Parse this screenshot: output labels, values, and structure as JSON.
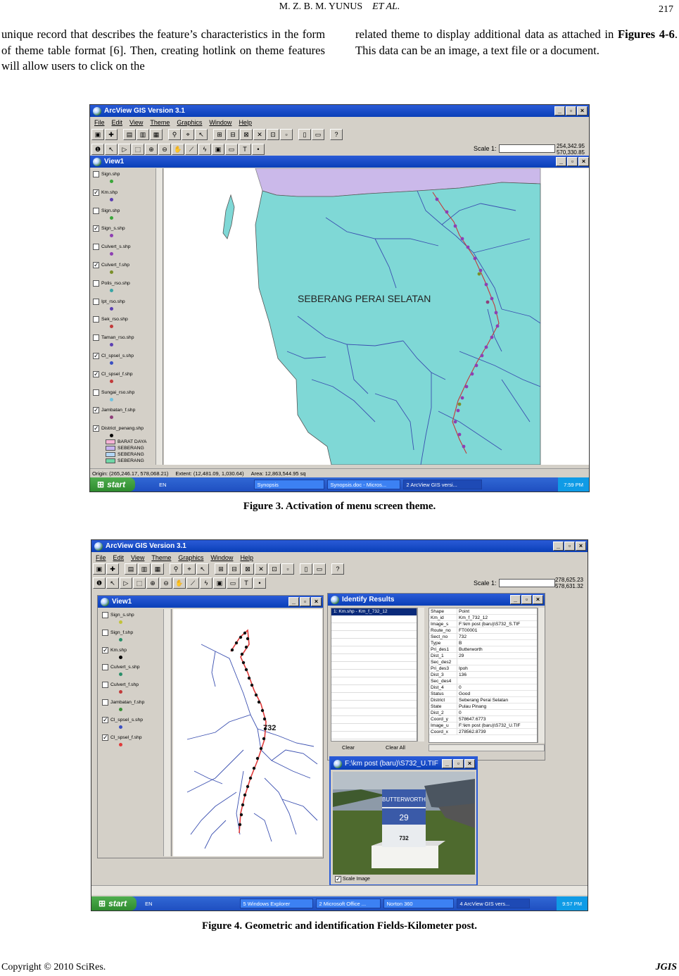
{
  "header": {
    "authors": "M. Z. B. M. YUNUS",
    "et_al": "ET AL.",
    "page_number": "217"
  },
  "body": {
    "left_column": "unique record that describes the feature’s characteristics in the form of theme table format [6]. Then, creating hotlink on theme features will allow users to click on the",
    "right_column_prefix": "related theme to display additional data as attached in ",
    "right_column_bold": "Figures 4-6",
    "right_column_suffix": ". This data can be an image, a text file or a document."
  },
  "figure3": {
    "caption": "Figure 3. Activation of menu screen theme.",
    "app_title": "ArcView GIS Version 3.1",
    "menus": [
      "File",
      "Edit",
      "View",
      "Theme",
      "Graphics",
      "Window",
      "Help"
    ],
    "scale_label": "Scale 1:",
    "coord_x": "254,342.95",
    "coord_y": "570,330.85",
    "view_title": "View1",
    "map_label": "SEBERANG PERAI SELATAN",
    "layers": [
      {
        "name": "Sign.shp",
        "checked": false,
        "color": "#3aa63a"
      },
      {
        "name": "Km.shp",
        "checked": true,
        "color": "#5b3fb3"
      },
      {
        "name": "Sign.shp",
        "checked": false,
        "color": "#3aa63a"
      },
      {
        "name": "Sign_s.shp",
        "checked": true,
        "color": "#8e3fb3"
      },
      {
        "name": "Culvert_s.shp",
        "checked": false,
        "color": "#8e3fb3"
      },
      {
        "name": "Culvert_f.shp",
        "checked": true,
        "color": "#7a8f2a"
      },
      {
        "name": "Polis_rso.shp",
        "checked": false,
        "color": "#3aa6a6"
      },
      {
        "name": "Ipt_rso.shp",
        "checked": false,
        "color": "#5b3fb3"
      },
      {
        "name": "Sek_rso.shp",
        "checked": false,
        "color": "#c23a3a"
      },
      {
        "name": "Taman_rso.shp",
        "checked": false,
        "color": "#5b3fb3"
      },
      {
        "name": "Cl_spsel_s.shp",
        "checked": true,
        "color": "#3a4fc2"
      },
      {
        "name": "Cl_spsel_f.shp",
        "checked": true,
        "color": "#c23a3a"
      },
      {
        "name": "Sungai_rso.shp",
        "checked": false,
        "color": "#6fc2e0"
      },
      {
        "name": "Jambatan_f.shp",
        "checked": true,
        "color": "#8e3f7a"
      },
      {
        "name": "District_penang.shp",
        "checked": true,
        "color": "#000"
      }
    ],
    "district_legend": [
      {
        "name": "BARAT DAYA",
        "color": "#f5b3d6"
      },
      {
        "name": "SEBERANG",
        "color": "#c8b3f0"
      },
      {
        "name": "SEBERANG",
        "color": "#b3d6f5"
      },
      {
        "name": "SEBERANG",
        "color": "#6fd6a6"
      }
    ],
    "status_origin": "Origin: (265,246.17, 578,068.21)",
    "status_extent": "Extent: (12,481.09, 1,030.64)",
    "status_area": "Area: 12,863,544.95 sq",
    "taskbar": {
      "start": "start",
      "lang": "EN",
      "tasks": [
        "Synopsis",
        "Synopsis.doc - Micros...",
        "2 ArcView GIS versi..."
      ],
      "clock": "7:59 PM"
    }
  },
  "figure4": {
    "caption": "Figure 4. Geometric and identification Fields-Kilometer post.",
    "app_title": "ArcView GIS Version 3.1",
    "menus": [
      "File",
      "Edit",
      "View",
      "Theme",
      "Graphics",
      "Window",
      "Help"
    ],
    "scale_label": "Scale 1:",
    "coord_x": "278,625.23",
    "coord_y": "578,631.32",
    "view_title": "View1",
    "layers": [
      {
        "name": "Sign_s.shp",
        "checked": false,
        "color": "#c2c23a"
      },
      {
        "name": "Sign_f.shp",
        "checked": false,
        "color": "#2a8f6a"
      },
      {
        "name": "Km.shp",
        "checked": true,
        "color": "#000"
      },
      {
        "name": "Culvert_s.shp",
        "checked": false,
        "color": "#2a8f6a"
      },
      {
        "name": "Culvert_f.shp",
        "checked": false,
        "color": "#c23a3a"
      },
      {
        "name": "Jambatan_f.shp",
        "checked": false,
        "color": "#3a8f3a"
      },
      {
        "name": "Cl_spsel_s.shp",
        "checked": true,
        "color": "#3a4fc2"
      },
      {
        "name": "Cl_spsel_f.shp",
        "checked": true,
        "color": "#e03a3a"
      }
    ],
    "map_label": "732",
    "identify": {
      "title": "Identify Results",
      "list_item": "1: Km.shp - Km_f_732_12",
      "clear_button": "Clear",
      "clear_all_button": "Clear All",
      "attributes": [
        [
          "Shape",
          "Point"
        ],
        [
          "Km_id",
          "Km_f_732_12"
        ],
        [
          "Image_s",
          "F:\\km post (baru)\\S732_S.TIF"
        ],
        [
          "Route_no",
          "FT00001"
        ],
        [
          "Sect_no",
          "732"
        ],
        [
          "Type",
          "B"
        ],
        [
          "Pri_des1",
          "Butterworth"
        ],
        [
          "Dist_1",
          "29"
        ],
        [
          "Sec_des2",
          ""
        ],
        [
          "Pri_des3",
          "Ipoh"
        ],
        [
          "Dist_3",
          "136"
        ],
        [
          "Sec_des4",
          ""
        ],
        [
          "Dist_4",
          "0"
        ],
        [
          "Status",
          "Good"
        ],
        [
          "District",
          "Seberang Perai Selatan"
        ],
        [
          "State",
          "Pulau Pinang"
        ],
        [
          "Dist_2",
          "0"
        ],
        [
          "Coord_y",
          "578647.6773"
        ],
        [
          "Image_u",
          "F:\\km post (baru)\\S732_U.TIF"
        ],
        [
          "Coord_x",
          "278562.8739"
        ]
      ]
    },
    "image_window": {
      "title": "F:\\km post (baru)\\S732_U.TIF",
      "post_top": "BUTTERWORTH",
      "post_mid": "29",
      "post_low": "732",
      "scale_checkbox": "Scale Image"
    },
    "taskbar": {
      "start": "start",
      "lang": "EN",
      "tasks": [
        "5 Windows Explorer",
        "2 Microsoft Office ...",
        "Norton 360",
        "4 ArcView GIS vers..."
      ],
      "clock": "9:57 PM"
    }
  },
  "footer": {
    "copyright": "Copyright © 2010 SciRes.",
    "journal": "JGIS"
  }
}
